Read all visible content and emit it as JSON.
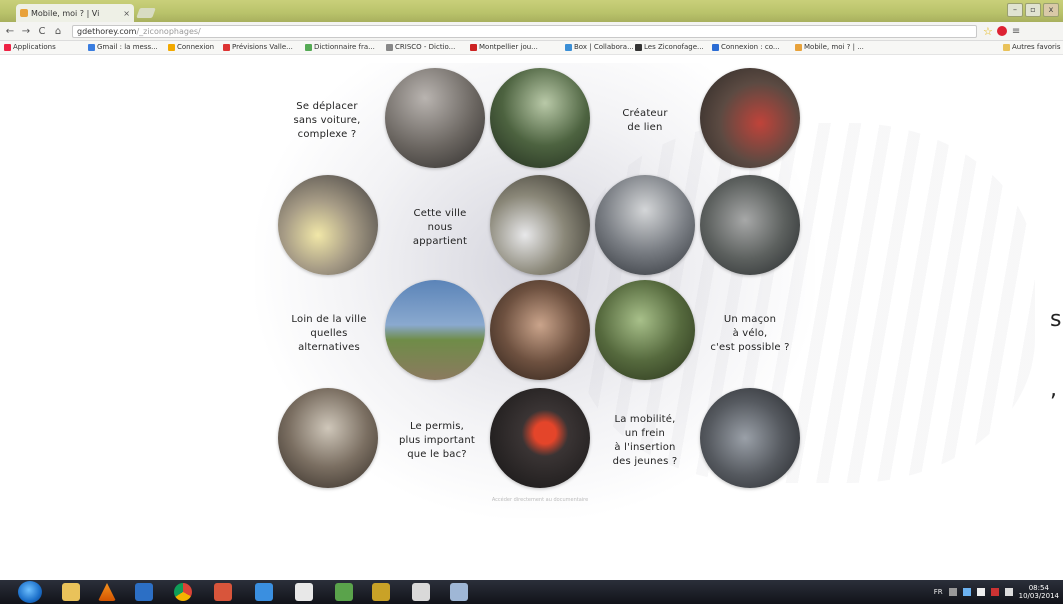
{
  "browser": {
    "tab_title": "Mobile, moi ? | Vi",
    "tab_close": "×",
    "url_domain": "gdethorey.com",
    "url_path": "/_zicono­phages/",
    "bookmarks": [
      {
        "label": "Applications",
        "color": "#e24"
      },
      {
        "label": "Gmail : la mess...",
        "color": "#3a7de0"
      },
      {
        "label": "Connexion",
        "color": "#f2a900"
      },
      {
        "label": "Prévisions Valle...",
        "color": "#d33"
      },
      {
        "label": "Dictionnaire fra...",
        "color": "#5a5"
      },
      {
        "label": "CRISCO - Dictio...",
        "color": "#888"
      },
      {
        "label": "Montpellier jou...",
        "color": "#c22"
      },
      {
        "label": "Box | Collabora...",
        "color": "#3b8fd6"
      },
      {
        "label": "Les Ziconofage...",
        "color": "#333"
      },
      {
        "label": "Connexion : co...",
        "color": "#2b6cd4"
      },
      {
        "label": "Mobile, moi ? | ...",
        "color": "#e8a23a"
      }
    ],
    "other_bookmarks": "Autres favoris"
  },
  "page": {
    "labels": {
      "se_deplacer": "Se déplacer\nsans voiture,\ncomplexe ?",
      "createur": "Créateur\nde lien",
      "cette_ville": "Cette ville\nnous\nappartient",
      "loin": "Loin de la ville\nquelles\nalternatives",
      "macon": "Un maçon\nà vélo,\nc'est possible ?",
      "permis": "Le permis,\nplus important\nque le bac?",
      "mobilite": "La mobilité,\nun frein\nà l'insertion\ndes jeunes ?"
    },
    "footer_link": "Accéder directement au documentaire",
    "edge_s": "s",
    "edge_comma": ","
  },
  "taskbar": {
    "lang": "FR",
    "time": "08:54",
    "date": "10/03/2014"
  },
  "colors": {
    "titlebar": "#b9c26a",
    "taskbar": "#1a1d25"
  }
}
